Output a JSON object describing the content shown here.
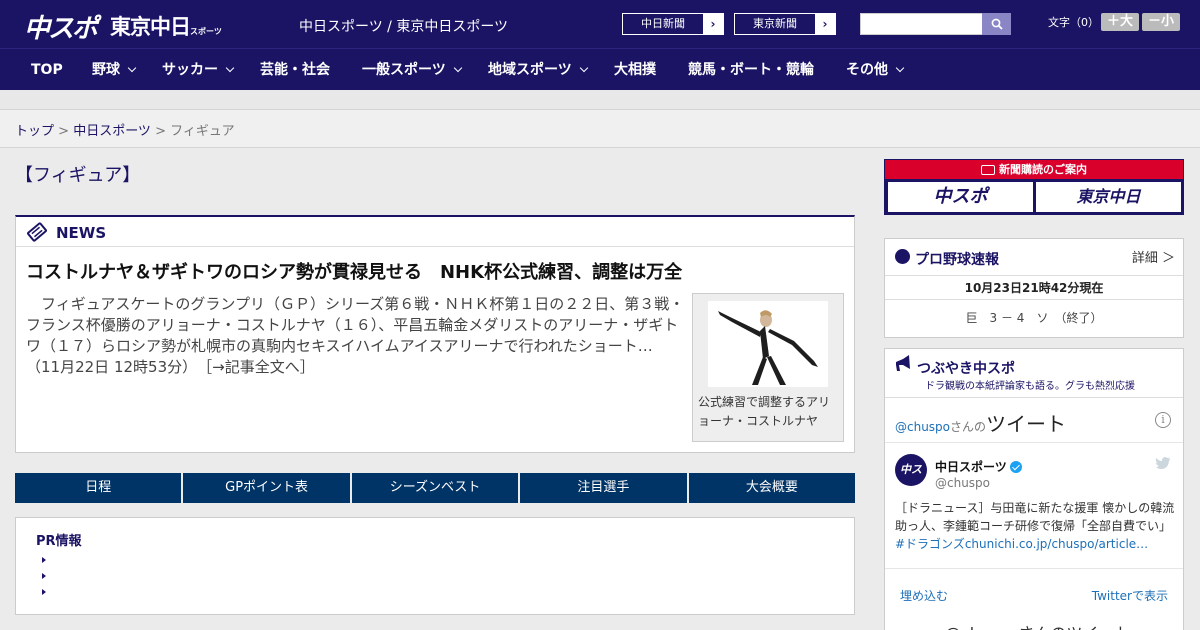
{
  "header": {
    "logo_chuspo": "中スポ",
    "logo_tokyo": "東京中日",
    "logo_tokyo_small": "スポーツ",
    "site_link": "中日スポーツ / 東京中日スポーツ",
    "paper_buttons": [
      "中日新聞",
      "東京新聞"
    ],
    "arrow_glyph": "›",
    "fontsize_label": "文字（0）",
    "font_larger": "＋大",
    "font_smaller": "－小"
  },
  "nav": {
    "items": [
      {
        "label": "TOP"
      },
      {
        "label": "野球"
      },
      {
        "label": "サッカー"
      },
      {
        "label": "芸能・社会"
      },
      {
        "label": "一般スポーツ"
      },
      {
        "label": "地域スポーツ"
      },
      {
        "label": "大相撲"
      },
      {
        "label": "競馬・ボート・競輪"
      },
      {
        "label": "その他"
      }
    ]
  },
  "breadcrumb": {
    "top": "トップ",
    "sep": " > ",
    "chunichi": "中日スポーツ",
    "current": "フィギュア"
  },
  "main": {
    "page_title": "【フィギュア】",
    "news_label": "NEWS",
    "article_title": "コストルナヤ＆ザギトワのロシア勢が貫禄見せる　NHK杯公式練習、調整は万全",
    "article_body": "フィギュアスケートのグランプリ（ＧＰ）シリーズ第６戦・ＮＨＫ杯第１日の２２日、第３戦・フランス杯優勝のアリョーナ・コストルナヤ（１６）、平昌五輪金メダリストのアリーナ・ザギトワ（１７）らロシア勢が札幌市の真駒内セキスイハイムアイスアリーナで行われたショート…（11月22日 12時53分）",
    "article_more": "［→記事全文へ］",
    "photo_caption": "公式練習で調整するアリョーナ・コストルナヤ",
    "tabs": [
      "日程",
      "GPポイント表",
      "シーズンベスト",
      "注目選手",
      "大会概要"
    ],
    "pr_title": "PR情報"
  },
  "sidebar": {
    "subscribe_head": "新聞購読のご案内",
    "subscribe_logo1": "中スポ",
    "subscribe_logo2": "東京中日",
    "baseball_title": "プロ野球速報",
    "baseball_detail": "詳細 ＞",
    "baseball_time": "10月23日21時42分現在",
    "baseball_score": "巨　3 － 4　ソ　（終了）",
    "tweet_title": "つぶやき中スポ",
    "tweet_sub": "ドラ観戦の本紙評論家も語る。グラも熱烈応援",
    "tweet_handle": "@chuspo",
    "tweet_handle_suffix": "さんの",
    "tweet_word": "ツイート",
    "tweet_user": "中日スポーツ",
    "tweet_text": "［ドラニュース］与田竜に新たな援軍 懐かしの韓流助っ人、李鍾範コーチ研修で復帰「全部自費でい」",
    "tweet_link": "#ドラゴンズchunichi.co.jp/chuspo/article…",
    "embed": "埋め込む",
    "view_on_twitter": "Twitterで表示",
    "bottom_text": "@chuspoさんのツイート"
  }
}
